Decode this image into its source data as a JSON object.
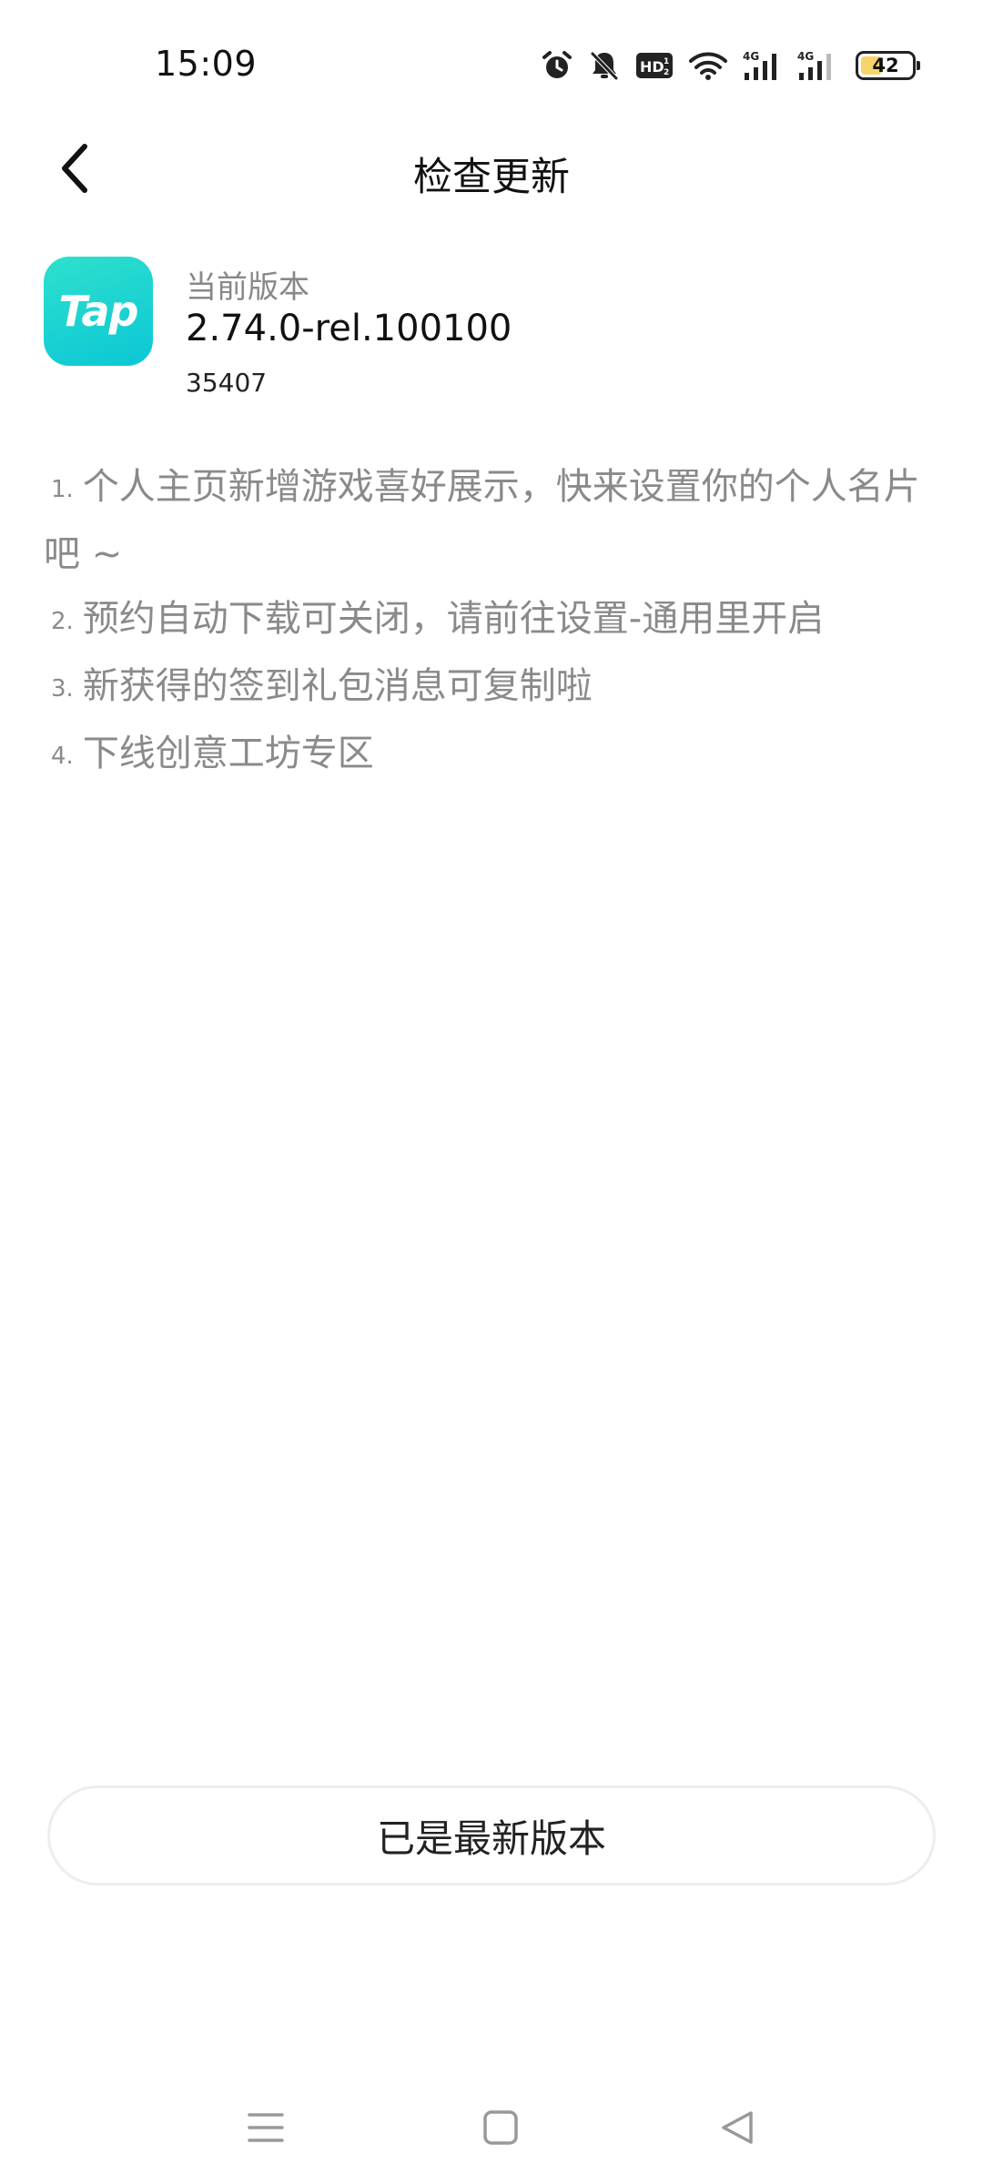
{
  "status_bar": {
    "time": "15:09",
    "icons": [
      "alarm-icon",
      "mute-icon",
      "hd-icon",
      "wifi-icon",
      "signal-4g-icon",
      "signal-4g-icon"
    ],
    "battery_level": "42",
    "battery_fraction": 0.42
  },
  "header": {
    "title": "检查更新",
    "back_icon": "chevron-left-icon"
  },
  "app": {
    "icon_text": "Tap",
    "icon_color": "#15d3d0",
    "version_label": "当前版本",
    "version": "2.74.0-rel.100100",
    "build": "35407"
  },
  "release_notes": [
    {
      "num": "1.",
      "text": "个人主页新增游戏喜好展示，快来设置你的个人名片吧 ~"
    },
    {
      "num": "2.",
      "text": "预约自动下载可关闭，请前往设置-通用里开启"
    },
    {
      "num": "3.",
      "text": "新获得的签到礼包消息可复制啦"
    },
    {
      "num": "4.",
      "text": "下线创意工坊专区"
    }
  ],
  "update_button": {
    "label": "已是最新版本"
  },
  "nav_bar": {
    "icons": [
      "menu-icon",
      "home-icon",
      "back-triangle-icon"
    ]
  }
}
